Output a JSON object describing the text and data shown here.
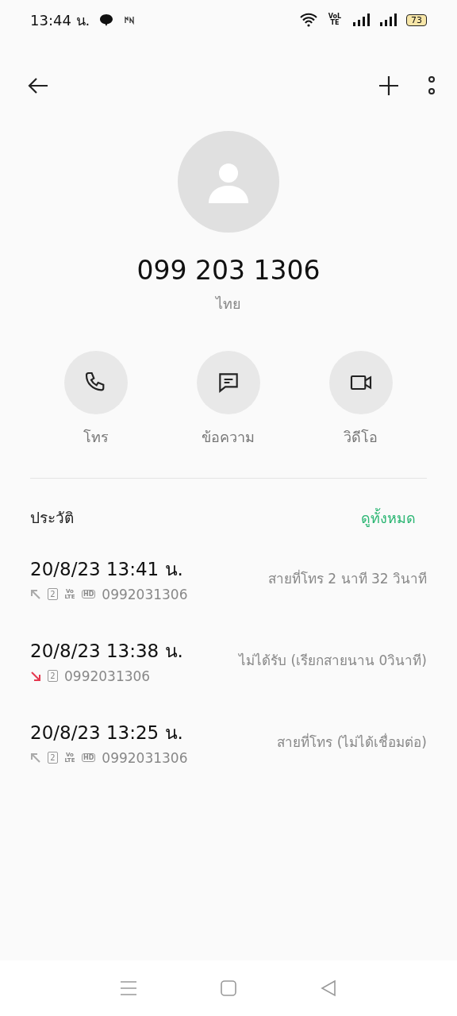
{
  "status_bar": {
    "time": "13:44 น.",
    "network_badge": "VoLTE",
    "battery": "73"
  },
  "contact": {
    "number": "099 203 1306",
    "location": "ไทย"
  },
  "actions": [
    {
      "kind": "call",
      "label": "โทร"
    },
    {
      "kind": "message",
      "label": "ข้อความ"
    },
    {
      "kind": "video",
      "label": "วิดีโอ"
    }
  ],
  "history": {
    "title": "ประวัติ",
    "see_all": "ดูทั้งหมด",
    "calls": [
      {
        "kind": "outgoing",
        "datetime": "20/8/23 13:41 น.",
        "sim": "2",
        "network_badge": "VoLTE",
        "quality_badge": "HD",
        "number": "0992031306",
        "detail": "สายที่โทร  2 นาที 32 วินาที"
      },
      {
        "kind": "missed",
        "datetime": "20/8/23 13:38 น.",
        "sim": "2",
        "number": "0992031306",
        "detail": "ไม่ได้รับ (เรียกสายนาน 0วินาที)"
      },
      {
        "kind": "outgoing",
        "datetime": "20/8/23 13:25 น.",
        "sim": "2",
        "network_badge": "VoLTE",
        "quality_badge": "HD",
        "number": "0992031306",
        "detail": "สายที่โทร (ไม่ได้เชื่อมต่อ)"
      }
    ]
  }
}
